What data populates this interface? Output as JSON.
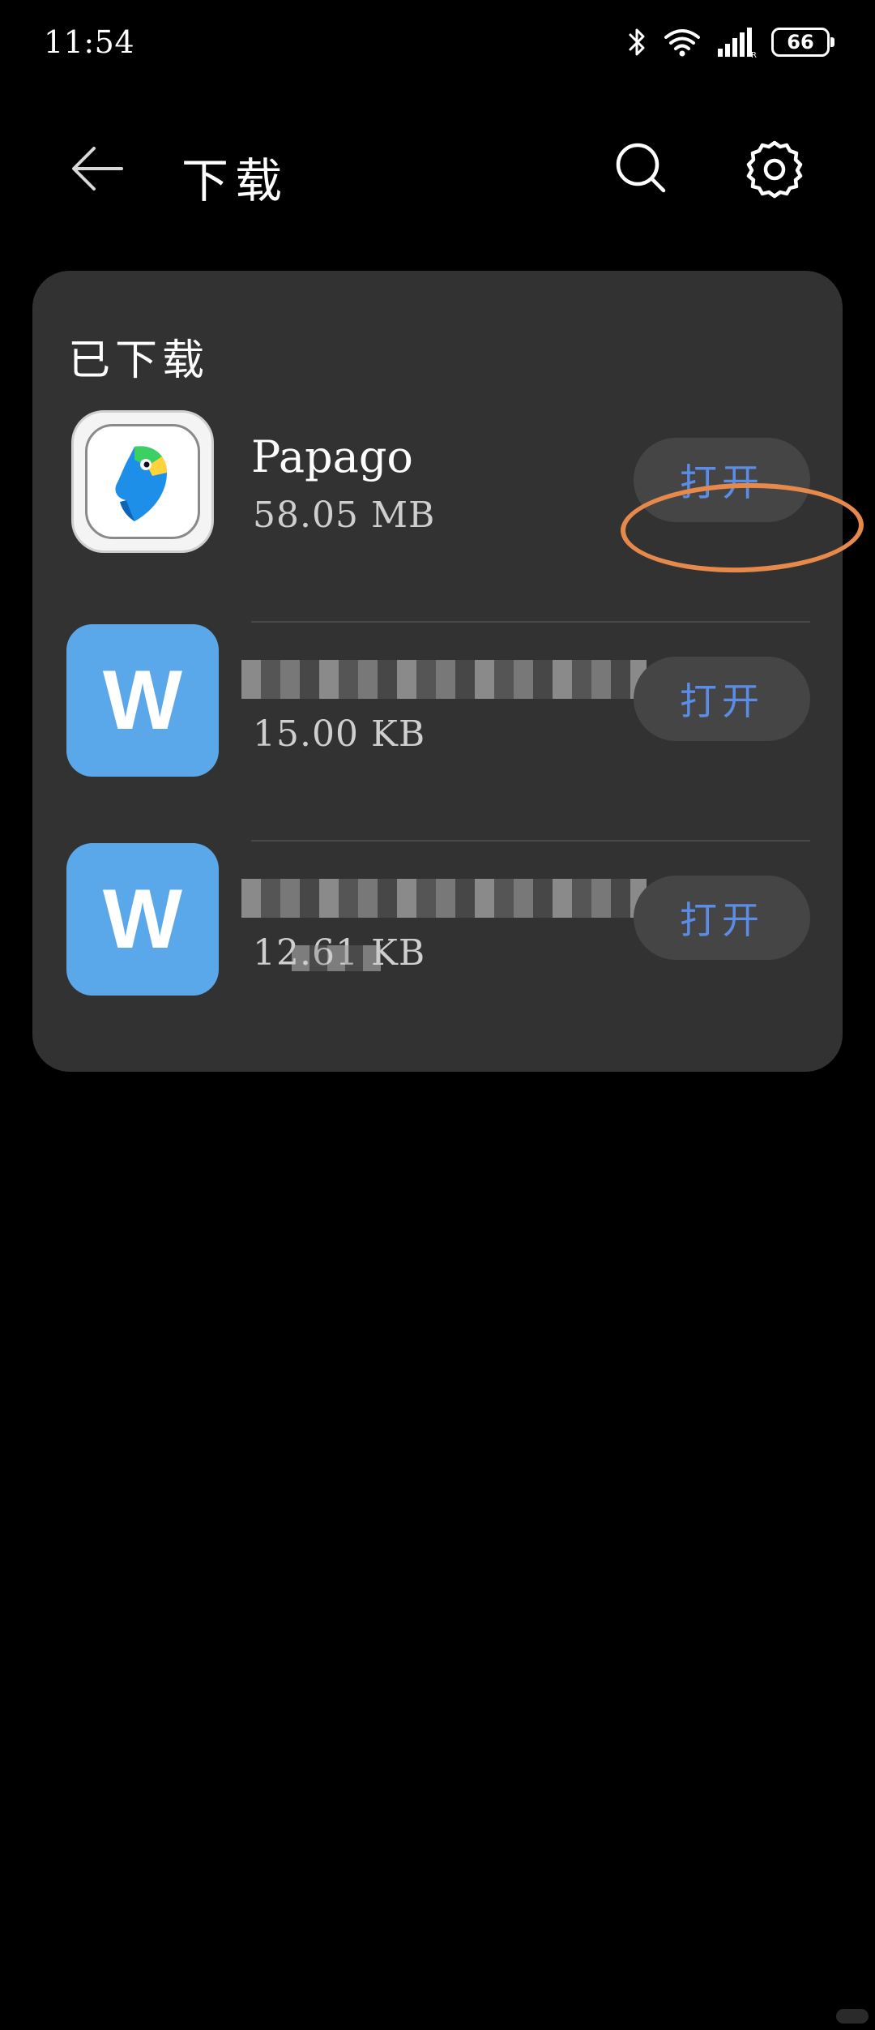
{
  "status_bar": {
    "time": "11:54",
    "battery_level": "66",
    "signal_suffix": "R"
  },
  "header": {
    "title": "下载",
    "back_icon": "back-arrow-icon",
    "search_icon": "search-icon",
    "settings_icon": "gear-icon"
  },
  "downloads": {
    "section_title": "已下载",
    "items": [
      {
        "name": "Papago",
        "size": "58.05  MB",
        "icon": "papago-parrot-icon",
        "action_label": "打开"
      },
      {
        "name": "",
        "size": "15.00  KB",
        "icon": "document-w-icon",
        "icon_letter": "W",
        "action_label": "打开"
      },
      {
        "name": "",
        "size": "12.61  KB",
        "icon": "document-w-icon",
        "icon_letter": "W",
        "action_label": "打开"
      }
    ]
  },
  "colors": {
    "background": "#000000",
    "card": "#323232",
    "button": "#454545",
    "button_text": "#5b8de8",
    "doc_icon": "#5aa7ea",
    "highlight": "#e6894a"
  }
}
